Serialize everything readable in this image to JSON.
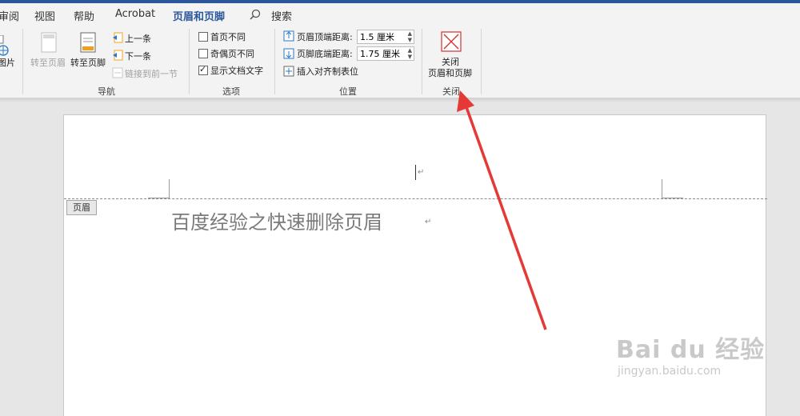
{
  "tabs": [
    "审阅",
    "视图",
    "帮助",
    "Acrobat",
    "页眉和页脚",
    "搜索"
  ],
  "active_tab": "页眉和页脚",
  "ribbon": {
    "picture_label": "图片",
    "goto_header": "转至页眉",
    "goto_footer": "转至页脚",
    "previous": "上一条",
    "next": "下一条",
    "link_previous": "链接到前一节",
    "nav_group": "导航",
    "diff_first": "首页不同",
    "diff_odd_even": "奇偶页不同",
    "show_doc_text": "显示文档文字",
    "show_doc_text_checked": true,
    "options_group": "选项",
    "header_top_label": "页眉顶端距离:",
    "header_top_value": "1.5 厘米",
    "footer_bottom_label": "页脚底端距离:",
    "footer_bottom_value": "1.75 厘米",
    "insert_align_tab": "插入对齐制表位",
    "position_group": "位置",
    "close_line1": "关闭",
    "close_line2": "页眉和页脚",
    "close_group": "关闭"
  },
  "document": {
    "header_tag": "页眉",
    "body_text": "百度经验之快速删除页眉",
    "para_mark": "↵"
  },
  "watermark": {
    "brand": "Bai du 经验",
    "url": "jingyan.baidu.com"
  },
  "colors": {
    "accent": "#2b579a",
    "arrow": "#e53935",
    "close_icon": "#d32f2f"
  }
}
